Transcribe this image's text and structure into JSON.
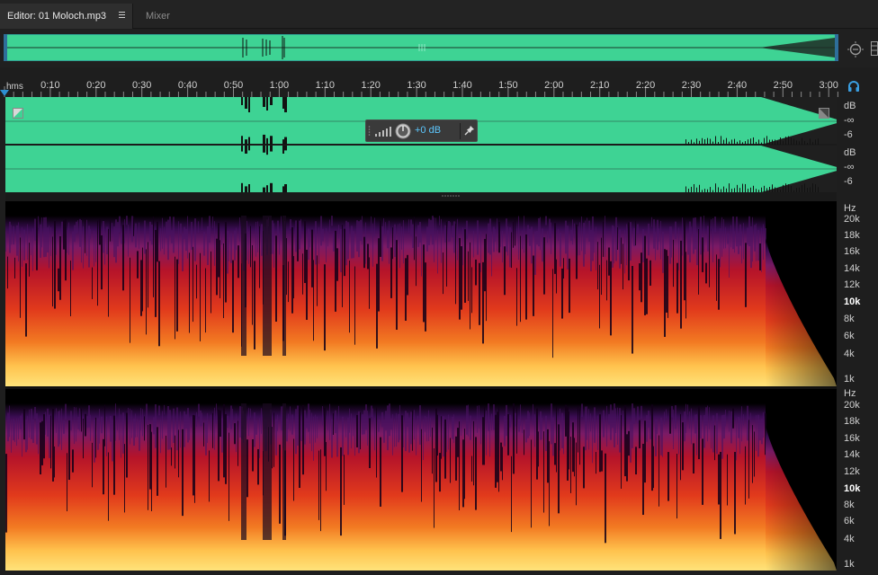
{
  "tabs": {
    "editor_label": "Editor: 01 Moloch.mp3",
    "mixer_label": "Mixer"
  },
  "ruler": {
    "unit_label": "hms",
    "ticks": [
      "0:10",
      "0:20",
      "0:30",
      "0:40",
      "0:50",
      "1:00",
      "1:10",
      "1:20",
      "1:30",
      "1:40",
      "1:50",
      "2:00",
      "2:10",
      "2:20",
      "2:30",
      "2:40",
      "2:50",
      "3:00"
    ]
  },
  "hud": {
    "volume_value": "+0 dB"
  },
  "amplitude_scale": {
    "channel1": [
      "dB",
      "-∞",
      "-6"
    ],
    "channel2": [
      "dB",
      "-∞",
      "-6"
    ]
  },
  "frequency_scale": {
    "channel1": [
      "Hz",
      "20k",
      "18k",
      "16k",
      "14k",
      "12k",
      "10k",
      "8k",
      "6k",
      "4k",
      "1k"
    ],
    "channel2": [
      "Hz",
      "20k",
      "18k",
      "16k",
      "14k",
      "12k",
      "10k",
      "8k",
      "6k",
      "4k",
      "1k"
    ],
    "highlighted": "10k"
  },
  "colors": {
    "waveform": "#3ed394",
    "waveform_bright": "#49e2a1",
    "accent_blue": "#2e8fd1",
    "volume_text": "#5dc8ff",
    "spectral_low": "#ffd463",
    "spectral_mid": "#e13a1c",
    "spectral_high": "#5a1a7a"
  },
  "icons": {
    "zoom": "zoom-icon",
    "headphones": "headphones-icon",
    "pin": "pin-icon",
    "volume_knob": "knob-icon",
    "meter": "meter-icon",
    "tab_menu": "menu-icon"
  }
}
